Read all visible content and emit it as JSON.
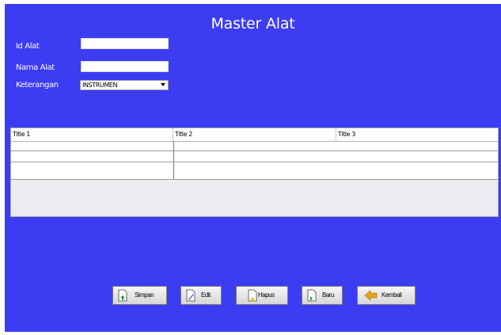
{
  "form": {
    "title": "Master Alat",
    "fields": {
      "id": {
        "label": "Id Alat",
        "value": ""
      },
      "nama": {
        "label": "Nama Alat",
        "value": ""
      },
      "keterangan": {
        "label": "Keterangan",
        "value": "INSTRUMEN"
      }
    }
  },
  "table": {
    "columns": [
      "Title 1",
      "Title 2",
      "Title 3"
    ],
    "rows": [
      [
        "",
        "",
        ""
      ],
      [
        "",
        "",
        ""
      ],
      [
        "",
        "",
        ""
      ]
    ]
  },
  "buttons": {
    "simpan": "Simpan",
    "edit": "Edit",
    "hapus": "Hapus",
    "baru": "Baru",
    "kembali": "Kembali"
  },
  "colors": {
    "panel": "#3c3cf2",
    "text": "#ffffff"
  },
  "icons": {
    "simpan": "document-save-icon",
    "edit": "document-edit-icon",
    "hapus": "document-delete-icon",
    "baru": "document-new-icon",
    "kembali": "back-arrow-icon"
  }
}
